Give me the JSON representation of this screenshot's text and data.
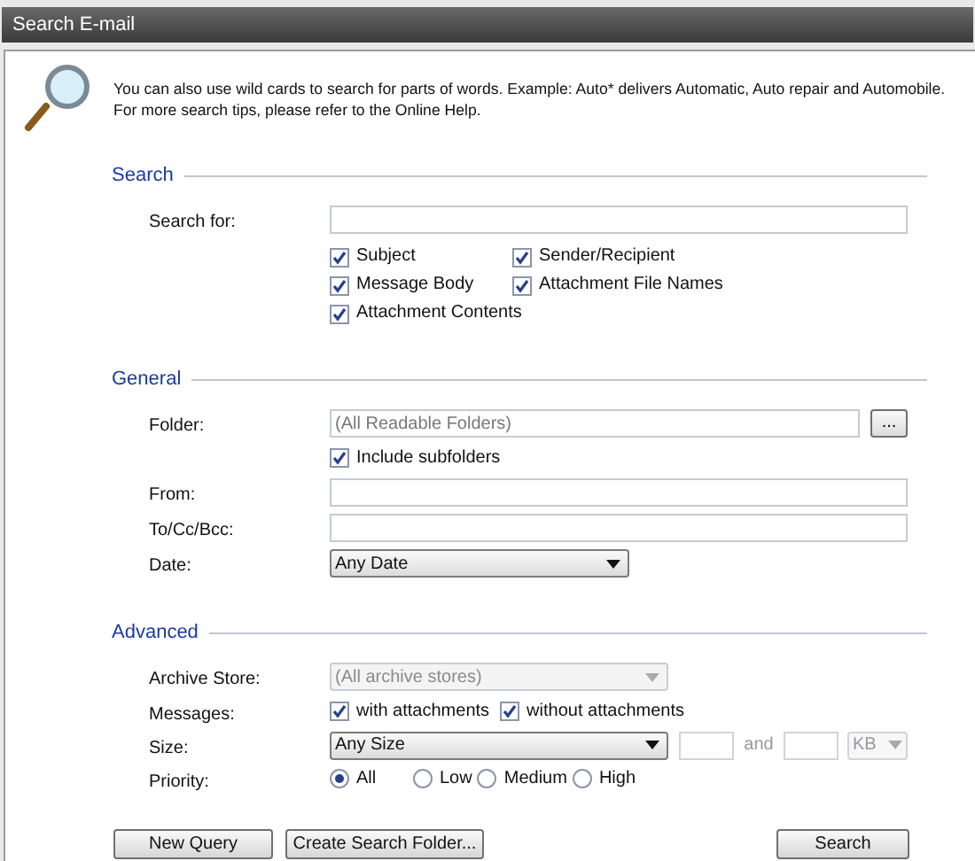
{
  "window": {
    "title": "Search E-mail"
  },
  "info": {
    "text": "You can also use wild cards to search for parts of words. Example: Auto* delivers Automatic, Auto repair and Automobile. For more search tips, please refer to the Online Help."
  },
  "sections": [
    {
      "title": "Search",
      "rows": [
        {
          "kind": "text",
          "label": "Search for:"
        },
        {
          "kind": "checkgrid",
          "items": [
            {
              "label": "Subject",
              "checked": true
            },
            {
              "label": "Sender/Recipient",
              "checked": true
            },
            {
              "label": "Message Body",
              "checked": true
            },
            {
              "label": "Attachment File Names",
              "checked": true
            },
            {
              "label": "Attachment Contents",
              "checked": true
            }
          ]
        }
      ]
    },
    {
      "title": "General",
      "rows": [
        {
          "kind": "folder",
          "label": "Folder:",
          "placeholder": "(All Readable Folders)",
          "button": "..."
        },
        {
          "kind": "checks",
          "items": [
            {
              "label": "Include subfolders",
              "checked": true
            }
          ]
        },
        {
          "kind": "text",
          "label": "From:"
        },
        {
          "kind": "text",
          "label": "To/Cc/Bcc:"
        },
        {
          "kind": "select",
          "label": "Date:",
          "value": "Any Date",
          "disabled": false
        }
      ]
    },
    {
      "title": "Advanced",
      "rows": [
        {
          "kind": "select",
          "label": "Archive Store:",
          "value": "(All archive stores)",
          "disabled": true
        },
        {
          "kind": "checks",
          "label": "Messages:",
          "items": [
            {
              "label": "with attachments",
              "checked": true
            },
            {
              "label": "without attachments",
              "checked": true
            }
          ]
        },
        {
          "kind": "size",
          "label": "Size:",
          "value": "Any Size",
          "between": "and",
          "unit": "KB"
        },
        {
          "kind": "radios",
          "label": "Priority:",
          "options": [
            {
              "label": "All",
              "selected": true
            },
            {
              "label": "Low",
              "selected": false
            },
            {
              "label": "Medium",
              "selected": false
            },
            {
              "label": "High",
              "selected": false
            }
          ]
        }
      ]
    }
  ],
  "buttons": [
    {
      "label": "New Query"
    },
    {
      "label": "Create Search Folder..."
    }
  ],
  "primary_button": {
    "label": "Search"
  }
}
